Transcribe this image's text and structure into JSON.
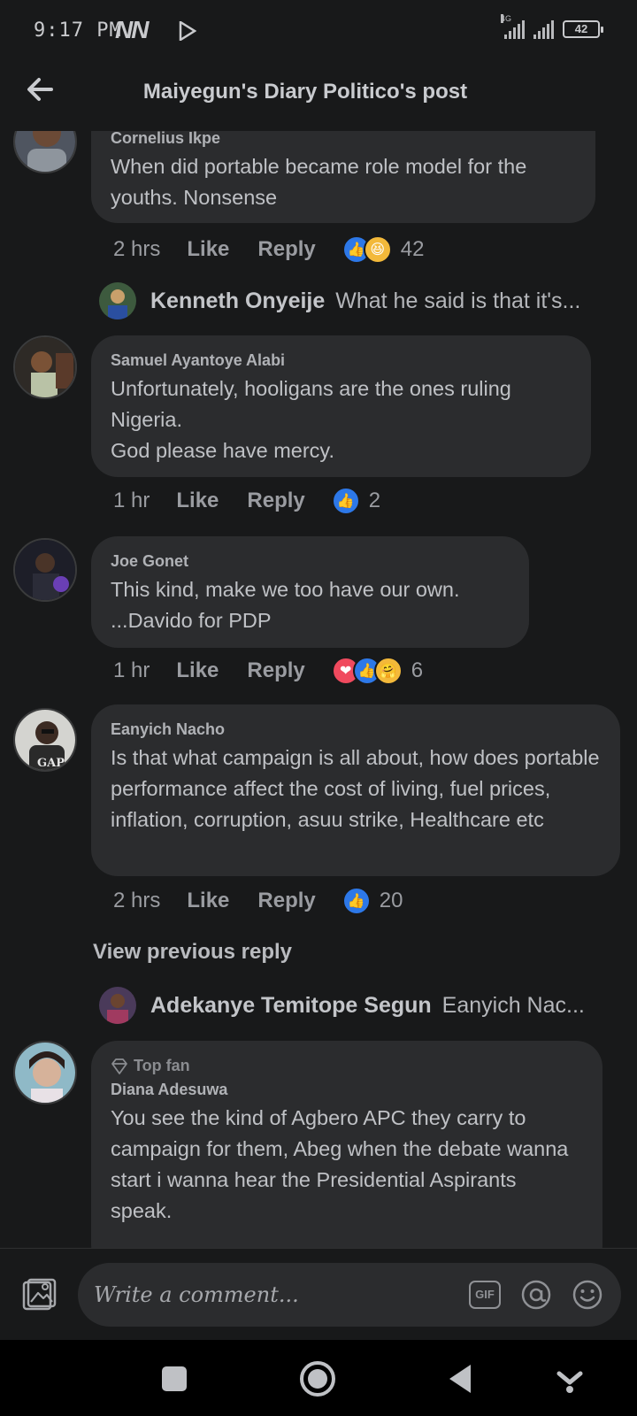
{
  "status_bar": {
    "time": "9:17 PM",
    "carrier_icons": "NN",
    "battery": "42",
    "network_label": "4G"
  },
  "header": {
    "title": "Maiyegun's Diary Politico's post"
  },
  "comments": [
    {
      "author": "Cornelius Ikpe",
      "text": "When did portable became role model for the youths.  Nonsense",
      "time": "2 hrs",
      "like_label": "Like",
      "reply_label": "Reply",
      "reactions": [
        "like",
        "haha"
      ],
      "reaction_count": "42"
    },
    {
      "author": "Samuel Ayantoye Alabi",
      "text": "Unfortunately, hooligans are the ones ruling Nigeria.\nGod please have mercy.",
      "time": "1 hr",
      "like_label": "Like",
      "reply_label": "Reply",
      "reactions": [
        "like"
      ],
      "reaction_count": "2"
    },
    {
      "author": "Joe Gonet",
      "text": "This kind, make we too have our own.\n...Davido for PDP",
      "time": "1 hr",
      "like_label": "Like",
      "reply_label": "Reply",
      "reactions": [
        "love",
        "like",
        "care"
      ],
      "reaction_count": "6"
    },
    {
      "author": "Eanyich Nacho",
      "text": "Is that what campaign is all about, how does portable performance affect the cost of living, fuel prices,  inflation,  corruption,  asuu strike, Healthcare etc",
      "time": "2 hrs",
      "like_label": "Like",
      "reply_label": "Reply",
      "reactions": [
        "like"
      ],
      "reaction_count": "20"
    },
    {
      "badge": "Top fan",
      "author": "Diana Adesuwa",
      "text": "You see the kind of Agbero APC they carry to campaign for them, Abeg when the debate wanna start i wanna hear the Presidential Aspirants speak."
    }
  ],
  "replies": [
    {
      "author": "Kenneth Onyeije",
      "snippet": "What he said is that it's..."
    },
    {
      "author": "Adekanye Temitope Segun",
      "snippet": "Eanyich Nac..."
    }
  ],
  "view_previous_reply": "View previous reply",
  "composer": {
    "placeholder": "Write a comment...",
    "gif_label": "GIF"
  },
  "colors": {
    "background": "#18191a",
    "bubble": "#2b2c2e",
    "like_blue": "#2d78e8",
    "love_red": "#f04a5e",
    "haha_yellow": "#f3b93a"
  }
}
